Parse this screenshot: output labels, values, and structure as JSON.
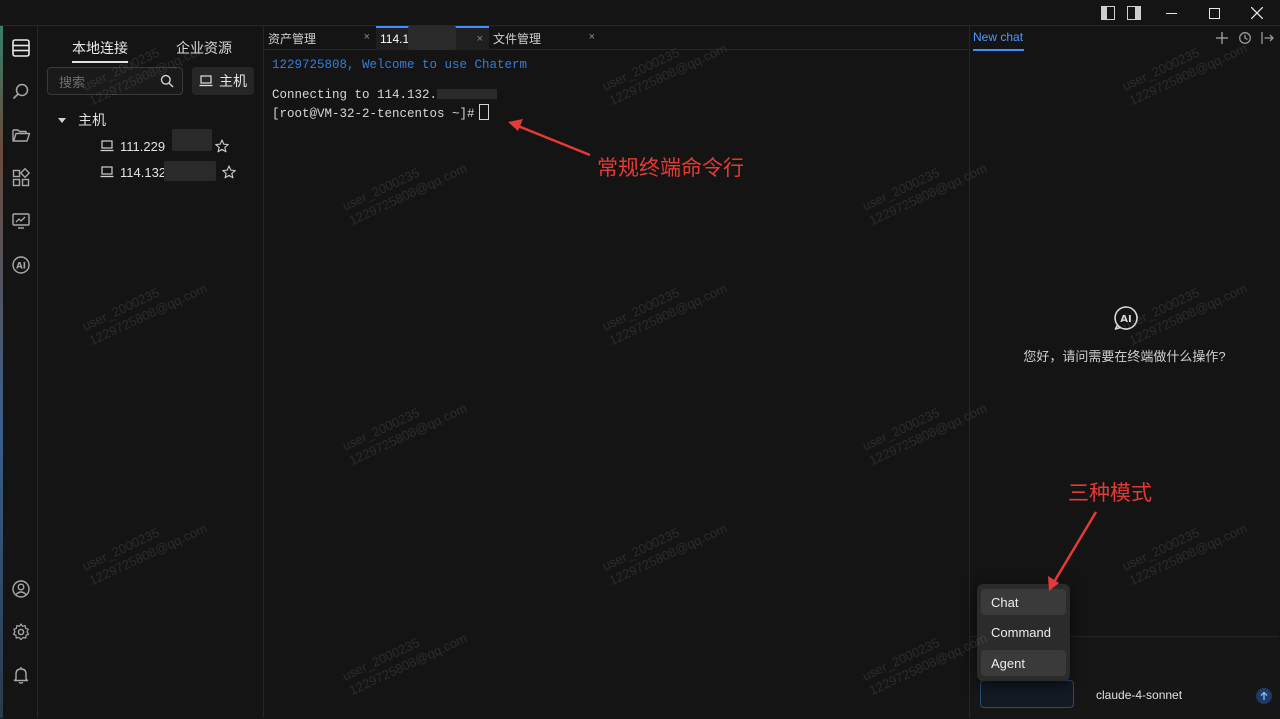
{
  "window": {
    "controls": [
      "sidebar-left-icon",
      "sidebar-right-icon",
      "gear-icon",
      "minimize-icon",
      "maximize-icon",
      "close-icon"
    ]
  },
  "activity_bar": {
    "top_icons": [
      "hosts-icon",
      "search-icon",
      "folder-icon",
      "apps-icon",
      "monitor-icon",
      "ai-icon"
    ],
    "bottom_icons": [
      "user-icon",
      "settings-icon",
      "bell-icon"
    ]
  },
  "sidebar": {
    "tabs": [
      "本地连接",
      "企业资源"
    ],
    "search_placeholder": "搜索",
    "host_button_label": "主机",
    "tree_group": "主机",
    "hosts": [
      {
        "label": "111.229"
      },
      {
        "label": "114.132"
      }
    ]
  },
  "main_tabs": [
    {
      "label": "资产管理",
      "close": "×"
    },
    {
      "label": "114.1",
      "close": "×"
    },
    {
      "label": "文件管理",
      "close": "×"
    }
  ],
  "terminal": {
    "welcome": "1229725808, Welcome to use Chaterm",
    "connecting": "Connecting to 114.132.",
    "prompt": "[root@VM-32-2-tencentos ~]#",
    "welcome_color": "#3a7bd5"
  },
  "ai_panel": {
    "tab_label": "New chat",
    "greeting": "您好，请问需要在终端做什么操作?",
    "model": "claude-4-sonnet",
    "modes": [
      "Chat",
      "Command",
      "Agent"
    ],
    "accent_color": "#3f8cff"
  },
  "annotations": {
    "terminal_note": "常规终端命令行",
    "modes_note": "三种模式",
    "color": "#e53935"
  },
  "watermark": {
    "line1": "user_2000235",
    "line2": "1229725808@qq.com"
  }
}
